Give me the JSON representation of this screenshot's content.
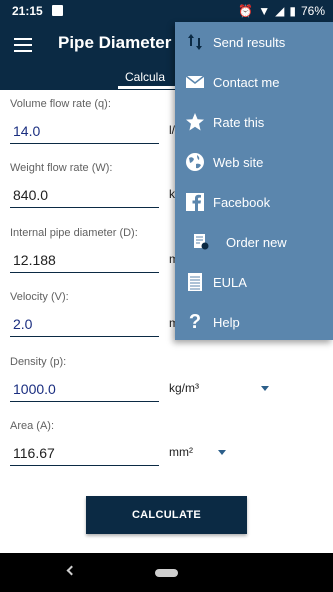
{
  "status_bar": {
    "time": "21:15",
    "battery": "76%"
  },
  "app_bar": {
    "title": "Pipe Diameter",
    "tab_label": "Calcula"
  },
  "form": {
    "fields": [
      {
        "label": "Volume flow rate (q):",
        "value": "14.0",
        "unit": "l/",
        "highlighted": true
      },
      {
        "label": "Weight flow rate (W):",
        "value": "840.0",
        "unit": "k",
        "highlighted": false
      },
      {
        "label": "Internal pipe diameter (D):",
        "value": "12.188",
        "unit": "m",
        "highlighted": false
      },
      {
        "label": "Velocity (V):",
        "value": "2.0",
        "unit": "m",
        "highlighted": true
      },
      {
        "label": "Density (p):",
        "value": "1000.0",
        "unit": "kg/m³",
        "highlighted": true
      },
      {
        "label": "Area (A):",
        "value": "116.67",
        "unit": "mm²",
        "highlighted": false
      }
    ]
  },
  "calculate_label": "CALCULATE",
  "menu": {
    "items": [
      {
        "label": "Send results",
        "icon": "sort-arrows-icon"
      },
      {
        "label": "Contact me",
        "icon": "envelope-icon"
      },
      {
        "label": "Rate this",
        "icon": "star-icon"
      },
      {
        "label": "Web site",
        "icon": "globe-icon"
      },
      {
        "label": "Facebook",
        "icon": "facebook-icon"
      },
      {
        "label": "Order new",
        "icon": "order-form-icon"
      },
      {
        "label": "EULA",
        "icon": "document-list-icon"
      },
      {
        "label": "Help",
        "icon": "question-mark-icon"
      }
    ]
  },
  "colors": {
    "primary": "#0b2a44",
    "menu_bg": "#5b86ad",
    "value_text": "#1a2e80"
  }
}
